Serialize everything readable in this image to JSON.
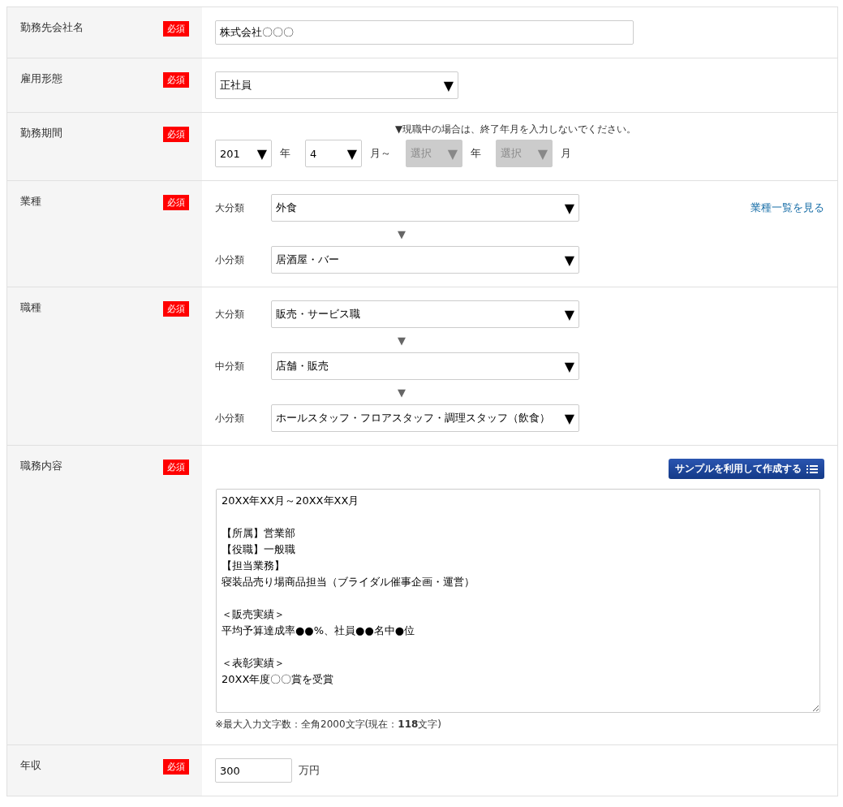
{
  "rows": [
    {
      "label": "勤務先会社名",
      "badge": "必須",
      "kind": "text",
      "value": "株式会社〇〇〇"
    },
    {
      "label": "雇用形態",
      "badge": "必須",
      "kind": "select",
      "value": "正社員",
      "arrow": "▼"
    },
    {
      "label": "勤務期間",
      "badge": "必須",
      "kind": "period",
      "note": "▼現職中の場合は、終了年月を入力しないでください。",
      "fields": [
        {
          "value": "201",
          "arrow": "▼",
          "unit": "年",
          "disabled": false
        },
        {
          "value": "4",
          "arrow": "▼",
          "unit": "月～",
          "disabled": false
        },
        {
          "value": "選択",
          "arrow": "▼",
          "unit": "年",
          "disabled": true
        },
        {
          "value": "選択",
          "arrow": "▼",
          "unit": "月",
          "disabled": true
        }
      ]
    },
    {
      "label": "業種",
      "badge": "必須",
      "kind": "cascade",
      "link": "業種一覧を見る",
      "connector": "▼",
      "levels": [
        {
          "label": "大分類",
          "value": "外食",
          "arrow": "▼"
        },
        {
          "label": "小分類",
          "value": "居酒屋・バー",
          "arrow": "▼"
        }
      ]
    },
    {
      "label": "職種",
      "badge": "必須",
      "kind": "cascade",
      "connector": "▼",
      "levels": [
        {
          "label": "大分類",
          "value": "販売・サービス職",
          "arrow": "▼"
        },
        {
          "label": "中分類",
          "value": "店舗・販売",
          "arrow": "▼"
        },
        {
          "label": "小分類",
          "value": "ホールスタッフ・フロアスタッフ・調理スタッフ（飲食）",
          "arrow": "▼"
        }
      ]
    },
    {
      "label": "職務内容",
      "badge": "必須",
      "kind": "textarea",
      "button": "サンプルを利用して作成する",
      "paragraphs": [
        [
          "20XX年XX月～20XX年XX月"
        ],
        [
          "【所属】営業部",
          "【役職】一般職",
          "【担当業務】",
          "寝装品売り場商品担当（ブライダル催事企画・運営）"
        ],
        [
          "＜販売実績＞",
          "平均予算達成率●●%、社員●●名中●位"
        ],
        [
          "＜表彰実績＞",
          "20XX年度〇〇賞を受賞"
        ]
      ],
      "counter": "※最大入力文字数：全角2000文字(現在：**118**文字)"
    },
    {
      "label": "年収",
      "badge": "必須",
      "kind": "income",
      "value": "300",
      "unit": "万円"
    }
  ]
}
